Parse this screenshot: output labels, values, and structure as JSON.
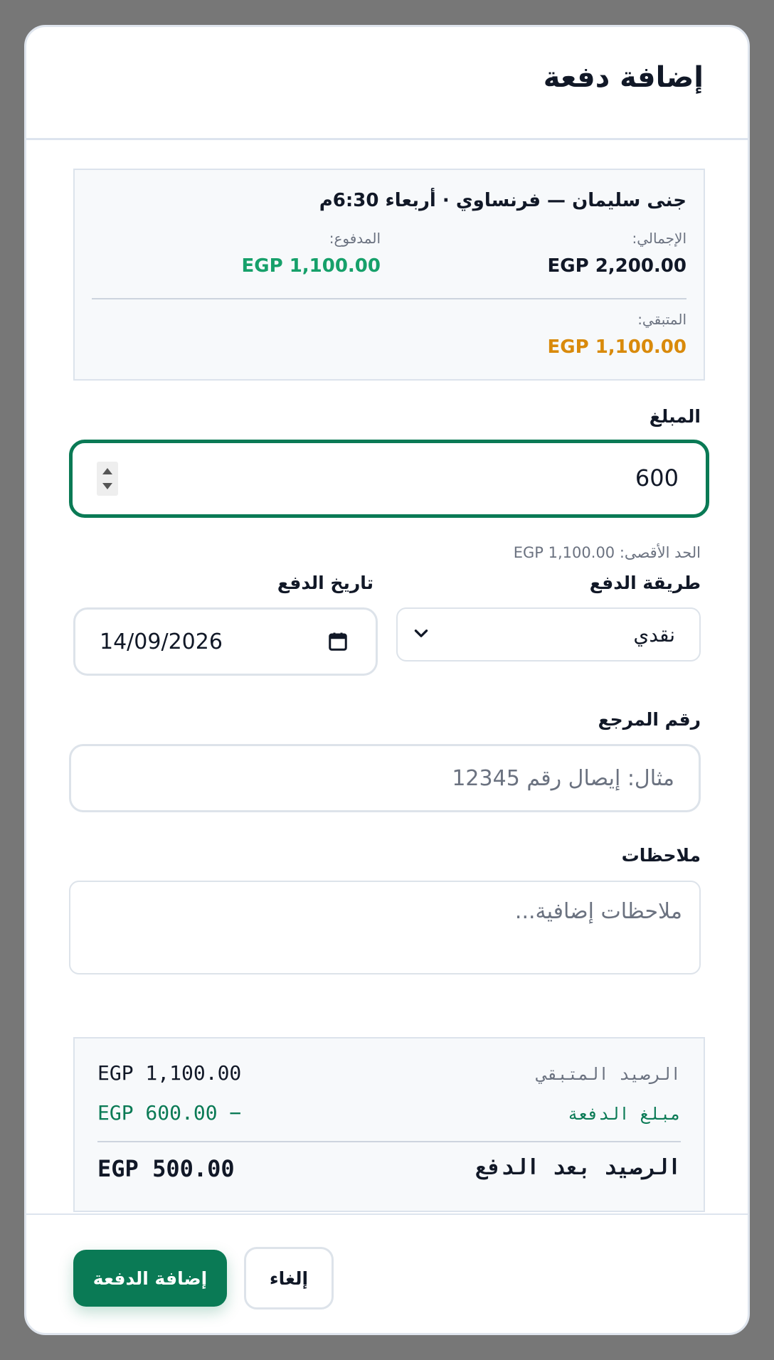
{
  "modal": {
    "title": "إضافة دفعة"
  },
  "summary": {
    "header": "جنى سليمان — فرنساوي · أربعاء 6:30م",
    "total_label": "الإجمالي:",
    "total_value": "EGP 2,200.00",
    "paid_label": "المدفوع:",
    "paid_value": "EGP 1,100.00",
    "remaining_label": "المتبقي:",
    "remaining_value": "EGP 1,100.00"
  },
  "amount": {
    "label": "المبلغ",
    "value": "600",
    "max_hint_label": "الحد الأقصى:",
    "max_hint_value": "EGP 1,100.00"
  },
  "method": {
    "label": "طريقة الدفع",
    "selected": "نقدي"
  },
  "date": {
    "label": "تاريخ الدفع",
    "value": "14/09/2026"
  },
  "reference": {
    "label": "رقم المرجع",
    "placeholder": "مثال: إيصال رقم 12345"
  },
  "notes": {
    "label": "ملاحظات",
    "placeholder": "ملاحظات إضافية..."
  },
  "calc": {
    "remaining_label": "الرصيد المتبقي",
    "remaining_value": "EGP 1,100.00",
    "payment_label": "مبلغ الدفعة",
    "payment_value": "EGP 600.00 −",
    "after_label": "الرصيد بعد الدفع",
    "after_value": "EGP 500.00"
  },
  "footer": {
    "submit_label": "إضافة الدفعة",
    "cancel_label": "إلغاء"
  },
  "colors": {
    "accent": "#0a7a55",
    "paid": "#16a06a",
    "remaining": "#d98a0b"
  }
}
